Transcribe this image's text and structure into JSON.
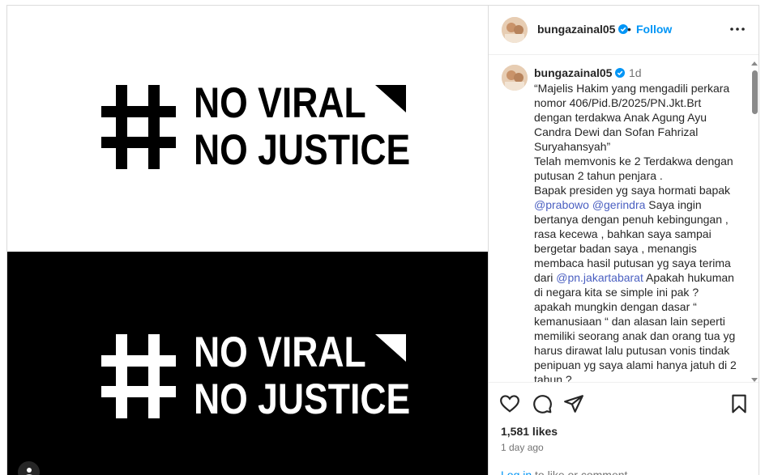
{
  "media": {
    "line1": "NO VIRAL",
    "line2": "NO JUSTICE",
    "hash_icon": "hashtag-icon",
    "colors": {
      "top_bg": "#ffffff",
      "top_fg": "#000000",
      "bottom_bg": "#000000",
      "bottom_fg": "#ffffff"
    }
  },
  "header": {
    "username": "bungazainal05",
    "separator": "•",
    "follow_label": "Follow",
    "more_icon": "more-horizontal-icon"
  },
  "caption": {
    "username": "bungazainal05",
    "time": "1d",
    "paragraphs": [
      "“Majelis Hakim yang mengadili perkara nomor 406/Pid.B/2025/PN.Jkt.Brt dengan terdakwa Anak Agung Ayu Candra Dewi dan Sofan Fahrizal Suryahansyah”",
      "Telah memvonis ke 2 Terdakwa dengan putusan 2 tahun penjara .",
      "Bapak presiden yg saya hormati bapak",
      "@prabowo",
      "@gerindra",
      "Saya ingin bertanya dengan penuh kebingungan , rasa kecewa , bahkan saya sampai bergetar badan saya , menangis membaca hasil putusan yg saya terima dari",
      "@pn.jakartabarat",
      "Apakah hukuman di negara kita se simple ini pak ? apakah mungkin dengan dasar “ kemanusiaan “ dan alasan lain seperti memiliki seorang anak dan orang tua yg harus dirawat lalu putusan vonis tindak penipuan yg saya alami hanya jatuh di 2 tahun ?"
    ]
  },
  "actions": {
    "icons": [
      "heart-icon",
      "comment-icon",
      "share-icon",
      "bookmark-icon"
    ],
    "likes": "1,581 likes",
    "posted": "1 day ago",
    "login_link": "Log in",
    "login_rest": " to like or comment."
  },
  "colors": {
    "accent": "#0095f6",
    "mention": "#4a5fc1",
    "muted": "#737373",
    "text": "#262626",
    "border": "#dbdbdb"
  }
}
